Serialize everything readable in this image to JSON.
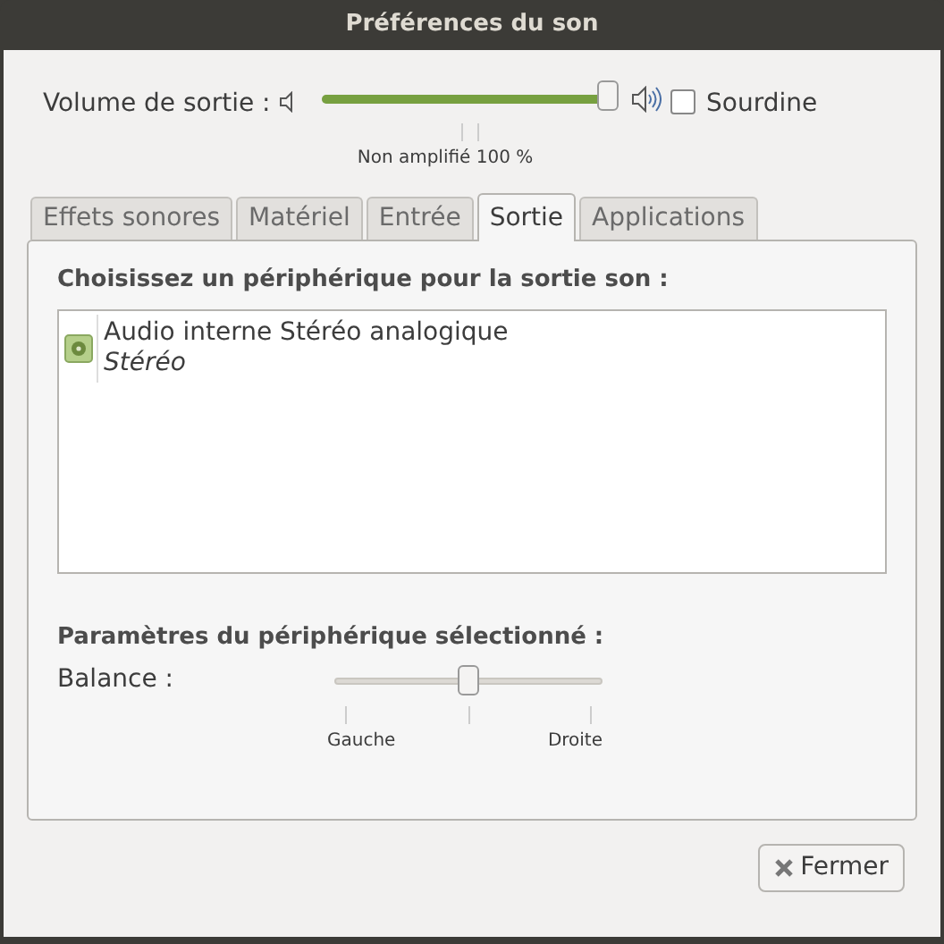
{
  "window": {
    "title": "Préférences du son"
  },
  "output_volume": {
    "label": "Volume de sortie :",
    "level": 1.0,
    "mark_label": "Non amplifié 100 %"
  },
  "mute": {
    "label": "Sourdine",
    "checked": false
  },
  "tabs": [
    {
      "label": "Effets sonores",
      "selected": false
    },
    {
      "label": "Matériel",
      "selected": false
    },
    {
      "label": "Entrée",
      "selected": false
    },
    {
      "label": "Sortie",
      "selected": true
    },
    {
      "label": "Applications",
      "selected": false
    }
  ],
  "device_heading": "Choisissez un périphérique pour la sortie son :",
  "devices": [
    {
      "name": "Audio interne Stéréo analogique",
      "profile": "Stéréo",
      "selected": true
    }
  ],
  "settings_heading": "Paramètres du périphérique sélectionné :",
  "balance": {
    "label": "Balance :",
    "level": 0.5,
    "left_label": "Gauche",
    "right_label": "Droite"
  },
  "buttons": [
    {
      "label": "Fermer"
    }
  ]
}
